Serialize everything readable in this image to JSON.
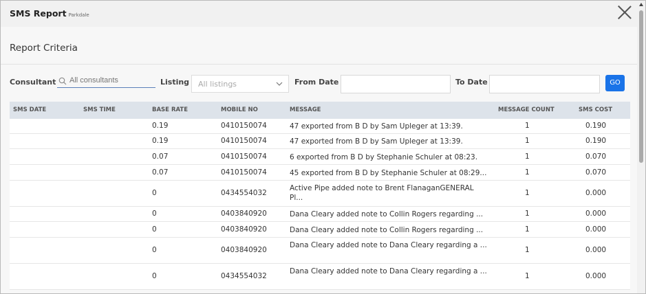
{
  "modal": {
    "title": "SMS Report",
    "subtitle": "Parkdale"
  },
  "criteria": {
    "section_title": "Report Criteria",
    "consultant_label": "Consultant",
    "consultant_placeholder": "All consultants",
    "listing_label": "Listing",
    "listing_placeholder": "All listings",
    "from_date_label": "From Date",
    "from_date_value": "",
    "to_date_label": "To Date",
    "to_date_value": "",
    "go_label": "GO"
  },
  "table": {
    "headers": [
      "SMS DATE",
      "SMS TIME",
      "BASE RATE",
      "MOBILE NO",
      "MESSAGE",
      "MESSAGE COUNT",
      "SMS COST"
    ],
    "rows": [
      {
        "date": "",
        "time": "",
        "rate": "0.19",
        "mobile": "0410150074",
        "message": "47 exported from B D by Sam Upleger at 13:39.",
        "count": "1",
        "cost": "0.190"
      },
      {
        "date": "",
        "time": "",
        "rate": "0.19",
        "mobile": "0410150074",
        "message": "47 exported from B D by Sam Upleger at 13:39.",
        "count": "1",
        "cost": "0.190"
      },
      {
        "date": "",
        "time": "",
        "rate": "0.07",
        "mobile": "0410150074",
        "message": "6 exported from B D by Stephanie Schuler at 08:23.",
        "count": "1",
        "cost": "0.070"
      },
      {
        "date": "",
        "time": "",
        "rate": "0.07",
        "mobile": "0410150074",
        "message": "45 exported from B D by Stephanie Schuler at 08:29...",
        "count": "1",
        "cost": "0.070"
      },
      {
        "date": "",
        "time": "",
        "rate": "0",
        "mobile": "0434554032",
        "message": "Active Pipe added note to Brent FlanaganGENERAL Pl...",
        "count": "1",
        "cost": "0.000"
      },
      {
        "date": "",
        "time": "",
        "rate": "0",
        "mobile": "0403840920",
        "message": "Dana Cleary added note to Collin Rogers regarding ...",
        "count": "1",
        "cost": "0.000"
      },
      {
        "date": "",
        "time": "",
        "rate": "0",
        "mobile": "0403840920",
        "message": "Dana Cleary added note to Collin Rogers regarding ...",
        "count": "1",
        "cost": "0.000"
      },
      {
        "date": "",
        "time": "",
        "rate": "0",
        "mobile": "0403840920",
        "message": "Dana Cleary added note to Dana Cleary regarding a ...",
        "count": "1",
        "cost": "0.000"
      },
      {
        "date": "",
        "time": "",
        "rate": "0",
        "mobile": "0434554032",
        "message": "Dana Cleary added note to Dana Cleary regarding a ...",
        "count": "1",
        "cost": "0.000"
      }
    ]
  },
  "icons": {
    "close": "close-icon",
    "search": "search-icon",
    "dropdown": "chevron-down-icon"
  },
  "colors": {
    "accent": "#1a73e8",
    "header_bg": "#f1f1f1",
    "table_header_bg": "#dde3ea"
  }
}
